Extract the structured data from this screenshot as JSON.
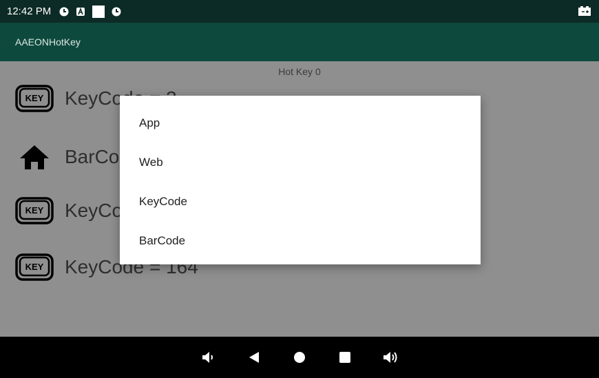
{
  "status_bar": {
    "time": "12:42 PM",
    "icons": [
      "clock-icon",
      "notification-a-icon",
      "white-square-icon",
      "clock-icon"
    ],
    "battery_icon": "battery-icon"
  },
  "app_bar": {
    "title": "AAEONHotKey"
  },
  "main": {
    "title": "Hot Key 0",
    "rows": [
      {
        "icon": "key-icon",
        "label": "KeyCode = 3"
      },
      {
        "icon": "home-icon",
        "label": "BarCode"
      },
      {
        "icon": "key-icon",
        "label": "KeyCode"
      },
      {
        "icon": "key-icon",
        "label": "KeyCode = 164"
      }
    ]
  },
  "dialog": {
    "items": [
      "App",
      "Web",
      "KeyCode",
      "BarCode"
    ]
  },
  "nav_bar": {
    "buttons": [
      "volume-down-icon",
      "back-icon",
      "home-icon",
      "recents-icon",
      "volume-up-icon"
    ]
  },
  "colors": {
    "status_bar": "#0d2b26",
    "app_bar": "#0d4a3d",
    "scrim_background": "#8f8f8f",
    "dialog": "#ffffff"
  }
}
